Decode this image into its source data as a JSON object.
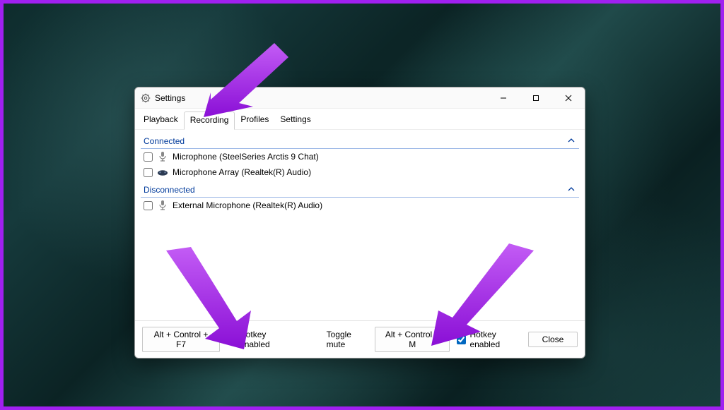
{
  "window": {
    "title": "Settings"
  },
  "tabs": {
    "playback": "Playback",
    "recording": "Recording",
    "profiles": "Profiles",
    "settings": "Settings",
    "active": "recording"
  },
  "groups": {
    "connected": {
      "title": "Connected",
      "devices": [
        {
          "label": "Microphone (SteelSeries Arctis 9 Chat)",
          "checked": false,
          "icon": "mic"
        },
        {
          "label": "Microphone Array (Realtek(R) Audio)",
          "checked": false,
          "icon": "mic-array"
        }
      ]
    },
    "disconnected": {
      "title": "Disconnected",
      "devices": [
        {
          "label": "External Microphone (Realtek(R) Audio)",
          "checked": false,
          "icon": "mic"
        }
      ]
    }
  },
  "footer": {
    "hotkey1_button": "Alt + Control + F7",
    "hotkey1_enabled_label": "Hotkey enabled",
    "hotkey1_enabled": true,
    "toggle_mute_label": "Toggle mute",
    "hotkey2_button": "Alt + Control + M",
    "hotkey2_enabled_label": "Hotkey enabled",
    "hotkey2_enabled": true,
    "close_button": "Close"
  },
  "colors": {
    "accent_purple": "#a020f0",
    "link_blue": "#003a9b",
    "checkbox_accent": "#0067c0"
  }
}
